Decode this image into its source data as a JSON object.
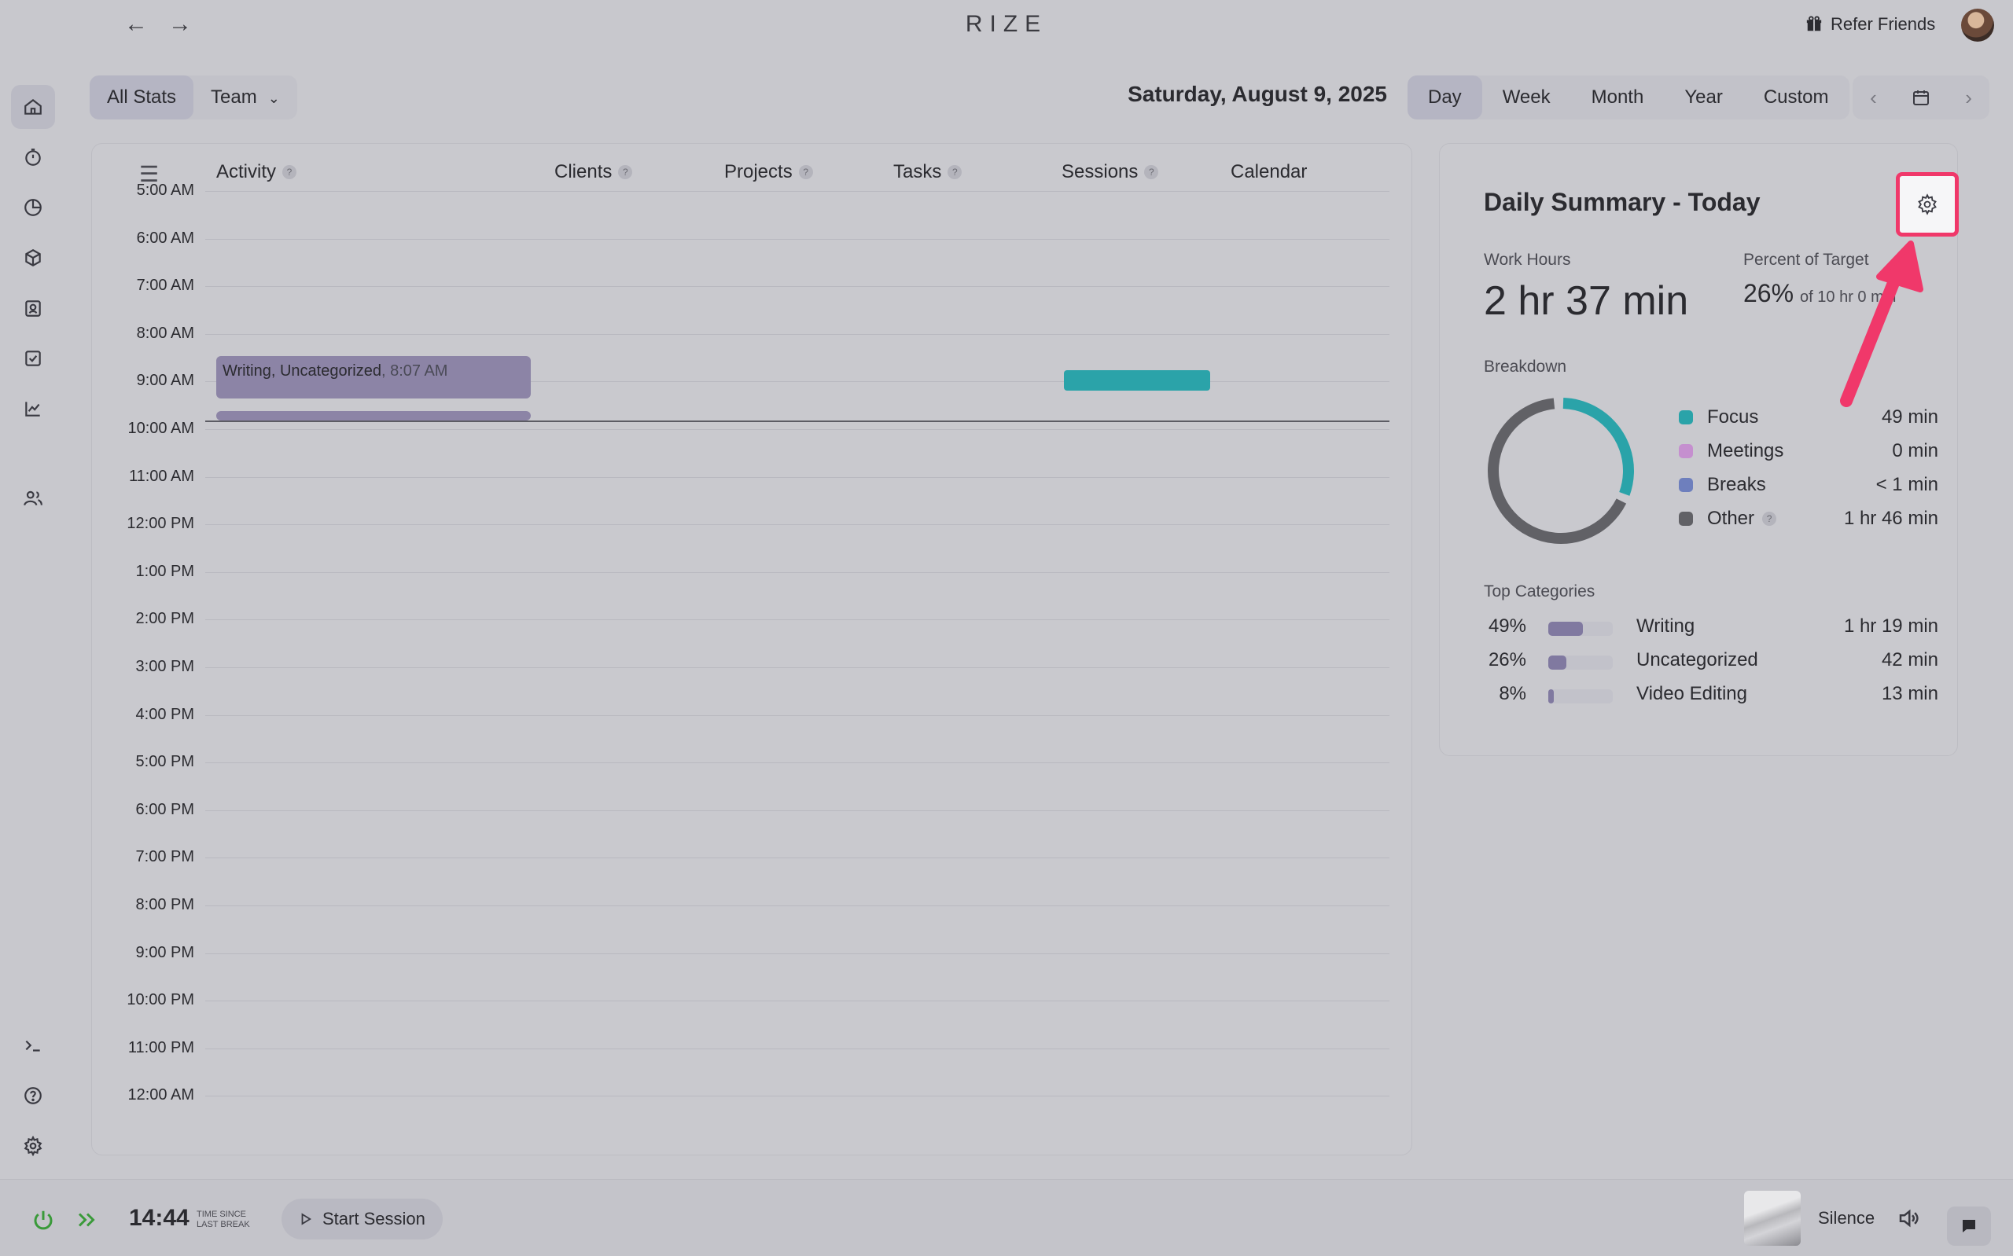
{
  "app": {
    "logo": "RIZE",
    "refer_label": "Refer Friends"
  },
  "filters": {
    "all_stats": "All Stats",
    "team": "Team"
  },
  "date_title": "Saturday, August 9, 2025",
  "range_tabs": [
    "Day",
    "Week",
    "Month",
    "Year",
    "Custom"
  ],
  "columns": {
    "activity": "Activity",
    "clients": "Clients",
    "projects": "Projects",
    "tasks": "Tasks",
    "sessions": "Sessions",
    "calendar": "Calendar"
  },
  "hours": [
    "5:00 AM",
    "6:00 AM",
    "7:00 AM",
    "8:00 AM",
    "9:00 AM",
    "10:00 AM",
    "11:00 AM",
    "12:00 PM",
    "1:00 PM",
    "2:00 PM",
    "3:00 PM",
    "4:00 PM",
    "5:00 PM",
    "6:00 PM",
    "7:00 PM",
    "8:00 PM",
    "9:00 PM",
    "10:00 PM",
    "11:00 PM",
    "12:00 AM"
  ],
  "event": {
    "title": "Writing, Uncategorized",
    "time": ", 8:07 AM"
  },
  "summary": {
    "title": "Daily Summary - Today",
    "work_hours_label": "Work Hours",
    "work_hours_value": "2 hr 37 min",
    "percent_label": "Percent of Target",
    "percent_value": "26%",
    "percent_sub": "of 10 hr 0 min",
    "breakdown_label": "Breakdown",
    "breakdown": [
      {
        "name": "Focus",
        "value": "49 min",
        "color": "#2aa3a9"
      },
      {
        "name": "Meetings",
        "value": "0 min",
        "color": "#c58fcf"
      },
      {
        "name": "Breaks",
        "value": "< 1 min",
        "color": "#6e7fbd"
      },
      {
        "name": "Other",
        "value": "1 hr 46 min",
        "color": "#616166"
      }
    ],
    "donut": {
      "focus_fraction": 0.31,
      "other_fraction": 0.67
    },
    "top_categories_label": "Top Categories",
    "categories": [
      {
        "percent": "49%",
        "name": "Writing",
        "time": "1 hr 19 min",
        "fill": 0.49
      },
      {
        "percent": "26%",
        "name": "Uncategorized",
        "time": "42 min",
        "fill": 0.26
      },
      {
        "percent": "8%",
        "name": "Video Editing",
        "time": "13 min",
        "fill": 0.08
      }
    ]
  },
  "bottom": {
    "clock": "14:44",
    "since_line1": "TIME SINCE",
    "since_line2": "LAST BREAK",
    "start_session": "Start Session",
    "silence": "Silence"
  },
  "colors": {
    "accent_teal": "#2aa3a9",
    "event_purple": "#8c84a6",
    "highlight_pink": "#f0386a"
  }
}
